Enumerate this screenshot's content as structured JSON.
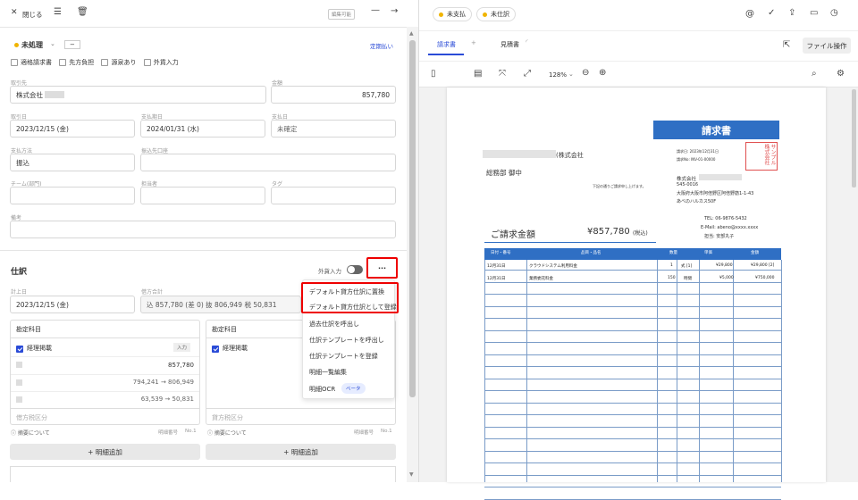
{
  "left": {
    "close_label": "閉じる",
    "edit_badge": "編集可能",
    "status": "未処理",
    "status_btn": "−",
    "regular_pay": "定期払い",
    "checks": [
      "適格請求書",
      "先方負担",
      "源泉あり",
      "外貨入力"
    ],
    "fields": {
      "partner_label": "取引先",
      "partner_value": "株式会社",
      "amount_label": "金額",
      "amount_value": "857,780",
      "date_label": "取引日",
      "date_value": "2023/12/15 (金)",
      "due_label": "支払期日",
      "due_value": "2024/01/31 (水)",
      "paydate_label": "支払日",
      "paydate_value": "未確定",
      "method_label": "支払方法",
      "method_value": "振込",
      "account_label": "振込先口座",
      "team_label": "チーム(部門)",
      "person_label": "担当者",
      "tag_label": "タグ",
      "note_label": "備考"
    },
    "journal": {
      "title": "仕訳",
      "fx_label": "外貨入力",
      "more": "···",
      "post_label": "計上日",
      "post_value": "2023/12/15 (金)",
      "total_label": "借方合計",
      "total_value": "込 857,780 (差 0)  抜 806,949  税 50,831",
      "col_header": "勘定科目",
      "left_col": {
        "account": "経理掲載",
        "tag": "入力",
        "amount": "857,780",
        "calc1": "794,241 → 806,949",
        "calc2": "63,539 → 50,831",
        "tax_placeholder": "借方税区分",
        "hint": "ⓘ 摘要について",
        "detail": "明細番号",
        "no": "No.1"
      },
      "right_col": {
        "account": "経理掲載",
        "tax_placeholder": "貸方税区分",
        "hint": "ⓘ 摘要について",
        "detail": "明細番号",
        "no": "No.1"
      },
      "add_line": "+ 明細追加"
    },
    "menu": [
      "デフォルト貸方仕訳に置換",
      "デフォルト貸方仕訳として登録",
      "過去仕訳を呼出し",
      "仕訳テンプレートを呼出し",
      "仕訳テンプレートを登録",
      "明細一覧編集",
      "明細OCR"
    ],
    "menu_badge": "ベータ"
  },
  "right": {
    "pills": [
      "未支払",
      "未仕訳"
    ],
    "tabs": [
      "請求書",
      "見積書"
    ],
    "file_btn": "ファイル操作",
    "zoom": "128%"
  },
  "invoice": {
    "title": "請求書",
    "to": "(株式会社",
    "dept": "総務部 御中",
    "greeting": "下記の通りご請求申し上げます。",
    "meta": [
      "請求日: 2023年12月31日",
      "請求No: INV-01-00000"
    ],
    "issuer": [
      "株式会社",
      "545-0016",
      "大阪府大阪市阿倍野区阿倍野筋1-1-43",
      "あべのハルカス50F"
    ],
    "contact": [
      "TEL: 06-9876-5432",
      "E-Mail: abeno@xxxx.xxxx",
      "担当: 安部丸子"
    ],
    "seal": "サンプル株式会社",
    "total_label": "ご請求金額",
    "total_value": "¥857,780",
    "total_note": "(税込)",
    "headers": [
      "日付・番号",
      "品目・品名",
      "数量",
      "単価",
      "金額"
    ],
    "rows": [
      [
        "12月31日",
        "クラウドシステム利用料金",
        "1",
        "式 [1]",
        "¥29,800",
        "¥29,800 [2]"
      ],
      [
        "12月31日",
        "業務委託料金",
        "150",
        "時間",
        "¥5,000",
        "¥750,000"
      ]
    ]
  }
}
